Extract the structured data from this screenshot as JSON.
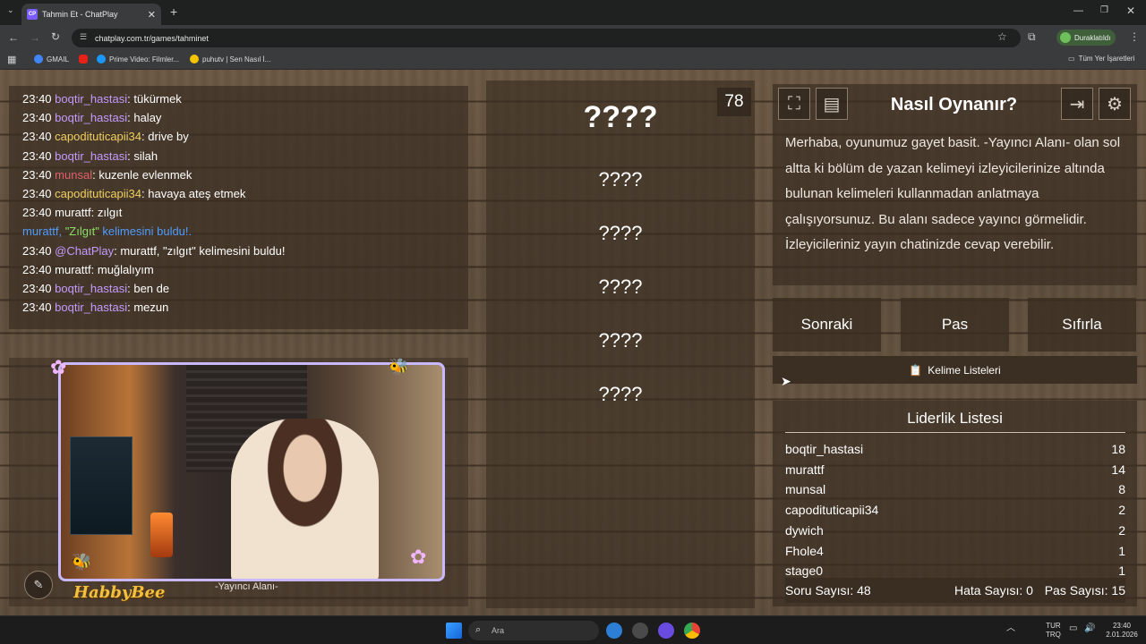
{
  "browser": {
    "tab_title": "Tahmin Et - ChatPlay",
    "tab_favicon": "CP",
    "url": "chatplay.com.tr/games/tahminet",
    "profile_label": "Duraklatıldı",
    "bookmarks": [
      {
        "label": "GMAIL",
        "icon": "google-icon"
      },
      {
        "label": "",
        "icon": "youtube-icon"
      },
      {
        "label": "Prime Video: Filmler...",
        "icon": "prime-icon"
      },
      {
        "label": "puhutv | Sen Nasıl İ...",
        "icon": "puhutv-icon"
      }
    ],
    "all_bookmarks": "Tüm Yer İşaretleri"
  },
  "chat": {
    "messages": [
      {
        "time": "23:40",
        "user": "boqtir_hastasi",
        "color": "purple",
        "text": ": tükürmek"
      },
      {
        "time": "23:40",
        "user": "boqtir_hastasi",
        "color": "purple",
        "text": ": halay"
      },
      {
        "time": "23:40",
        "user": "capodituticapii34",
        "color": "yellow",
        "text": ": drive by"
      },
      {
        "time": "23:40",
        "user": "boqtir_hastasi",
        "color": "purple",
        "text": ": silah"
      },
      {
        "time": "23:40",
        "user": "munsal",
        "color": "red",
        "text": ": kuzenle evlenmek"
      },
      {
        "time": "23:40",
        "user": "capodituticapii34",
        "color": "yellow",
        "text": ": havaya ateş etmek"
      },
      {
        "time": "23:40",
        "user": "murattf",
        "color": "white",
        "text": ": zılgıt"
      }
    ],
    "system_line": {
      "prefix": "murattf, ",
      "word": "\"Zılgıt\"",
      "suffix": " kelimesini buldu!."
    },
    "messages2": [
      {
        "time": "23:40",
        "user": "@ChatPlay",
        "color": "purple",
        "text": ": murattf, \"zılgıt\" kelimesini buldu!"
      },
      {
        "time": "23:40",
        "user": "murattf",
        "color": "white",
        "text": ": muğlalıyım"
      },
      {
        "time": "23:40",
        "user": "boqtir_hastasi",
        "color": "purple",
        "text": ": ben de"
      },
      {
        "time": "23:40",
        "user": "boqtir_hastasi",
        "color": "purple",
        "text": ": mezun"
      }
    ]
  },
  "camera": {
    "streamer_name": "HabbyBee",
    "label": "-Yayıncı Alanı-"
  },
  "words": {
    "main": "????",
    "forbidden": [
      "????",
      "????",
      "????",
      "????",
      "????"
    ],
    "timer": "78"
  },
  "howto": {
    "title": "Nasıl Oynanır?",
    "text": "Merhaba, oyunumuz gayet basit. -Yayıncı Alanı- olan sol altta ki bölüm de yazan kelimeyi izleyicilerinize altında bulunan kelimeleri kullanmadan anlatmaya çalışıyorsunuz. Bu alanı sadece yayıncı görmelidir. İzleyicileriniz yayın chatinizde cevap verebilir."
  },
  "controls": {
    "next": "Sonraki",
    "pass": "Pas",
    "reset": "Sıfırla",
    "word_lists": "Kelime Listeleri"
  },
  "leaderboard": {
    "title": "Liderlik Listesi",
    "rows": [
      {
        "name": "boqtir_hastasi",
        "score": "18"
      },
      {
        "name": "murattf",
        "score": "14"
      },
      {
        "name": "munsal",
        "score": "8"
      },
      {
        "name": "capodituticapii34",
        "score": "2"
      },
      {
        "name": "dywich",
        "score": "2"
      },
      {
        "name": "Fhole4",
        "score": "1"
      },
      {
        "name": "stage0",
        "score": "1"
      }
    ],
    "questions": "Soru Sayısı: 48",
    "errors": "Hata Sayısı: 0",
    "passes": "Pas Sayısı: 15"
  },
  "taskbar": {
    "search_placeholder": "Ara",
    "lang_top": "TUR",
    "lang_bottom": "TRQ",
    "time": "23:40",
    "date": "2.01.2026"
  },
  "colors": {
    "purple": "#c59bff",
    "yellow": "#f0d060",
    "red": "#e0606a",
    "white": "#ffffff",
    "system": "#4f9cff",
    "highlight": "#8ee06a"
  }
}
